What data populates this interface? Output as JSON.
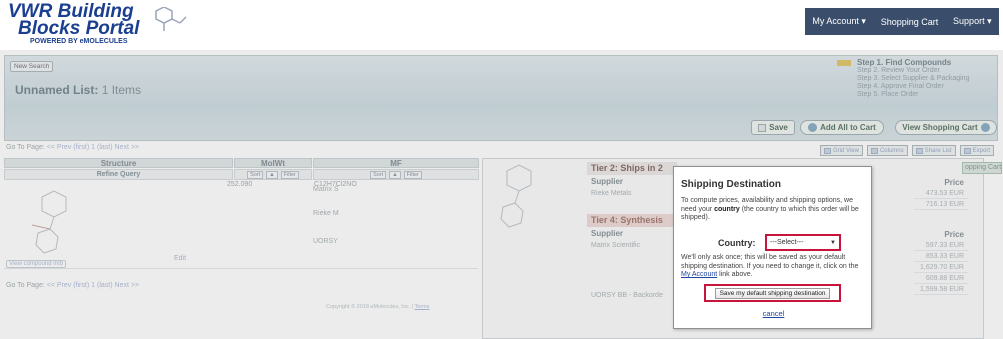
{
  "header": {
    "logo_line1": "VWR Building",
    "logo_line2": "Blocks Portal",
    "logo_powered": "POWERED BY eMOLECULES",
    "nav": [
      "My Account ▾",
      "Shopping Cart",
      "Support ▾"
    ]
  },
  "banner": {
    "new_search": "New Search",
    "list_name": "Unnamed List:",
    "list_count": "1 Items",
    "steps": [
      "Step 1. Find Compounds",
      "Step 2. Review Your Order",
      "Step 3. Select Supplier & Packaging",
      "Step 4. Approve Final Order",
      "Step 5. Place Order"
    ],
    "save": "Save",
    "add_all": "Add All to Cart",
    "view_cart": "View Shopping Cart"
  },
  "pager": {
    "label": "Go To Page:",
    "prev": "<< Prev",
    "first": "(first)",
    "page": "1",
    "last": "(last)",
    "next": "Next >>"
  },
  "view_buttons": [
    "Grid View",
    "Columns",
    "Share List",
    "Export"
  ],
  "table": {
    "headers": [
      "Structure",
      "MolWt",
      "MF"
    ],
    "refine": "Refine Query",
    "sort": "Sort",
    "filter": "Filter",
    "row": {
      "molwt": "252.090",
      "mf": "C12H7Cl2NO",
      "view_molfile": "View compound mlb",
      "edit": "Edit"
    }
  },
  "suppliers_bg": {
    "tier2": "Tier 2: Ships in 2",
    "tier4": "Tier 4: Synthesis",
    "supplier_label": "Supplier",
    "price_label": "Price",
    "tier2_rows": [
      "Rieke Metals"
    ],
    "tier4_rows": [
      "Matrix Scientific",
      "UORSY BB - Backorde"
    ],
    "partial_rows": [
      "Matrix S",
      "Rieke M",
      "UORSY"
    ],
    "prices_top": [
      "473.53 EUR",
      "716.13 EUR"
    ],
    "prices_bottom": [
      "597.33 EUR",
      "853.33 EUR",
      "1,629.70 EUR",
      "609.88 EUR",
      "1,599.58 EUR"
    ],
    "shopping_cart_tab": "opping Cart"
  },
  "dialog": {
    "title": "Shipping Destination",
    "intro_before": "To compute prices, availability and shipping options, we need your ",
    "intro_bold": "country",
    "intro_after": " (the country to which this order will be shipped).",
    "country_label": "Country:",
    "country_value": "---Select---",
    "note_before": "We'll only ask once; this will be saved as your default shipping destination. If you need to change it, click on the ",
    "note_link": "My Account",
    "note_after": " link above.",
    "save_default": "Save my default shipping destination",
    "cancel": "cancel"
  },
  "footer": {
    "copyright": "Copyright © 2018 eMolecules, Inc. |",
    "terms": "Terms"
  },
  "colors": {
    "brand": "#1b3f8f",
    "nav_bg": "#3a4e6b",
    "highlight": "#c8143c"
  }
}
